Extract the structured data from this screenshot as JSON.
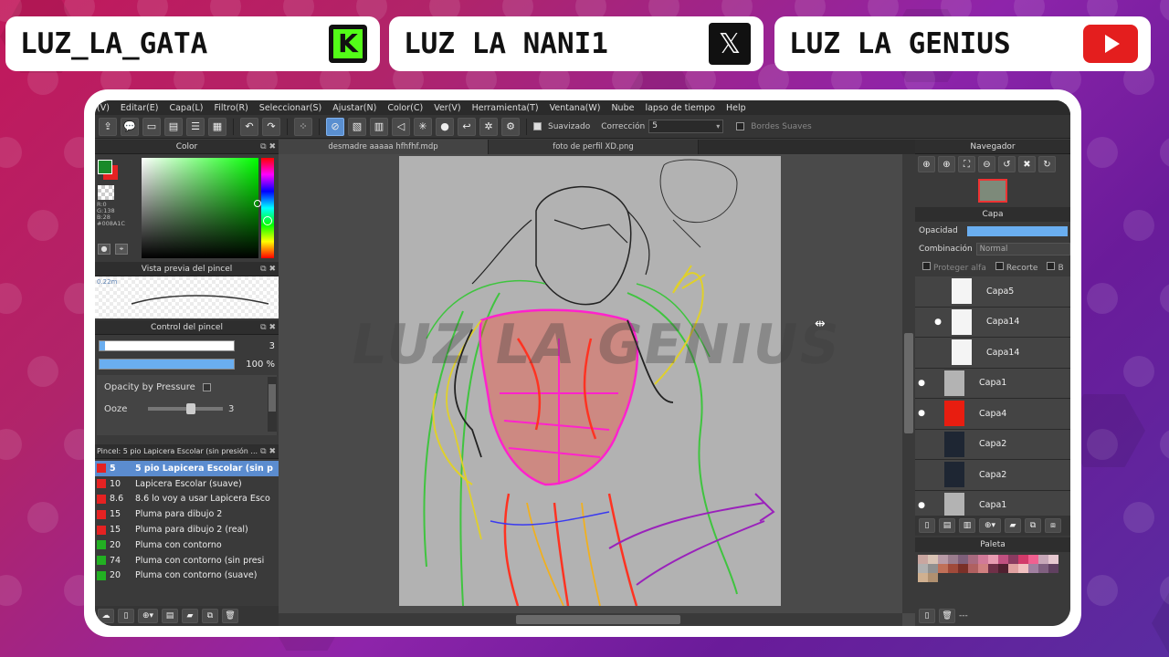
{
  "social": {
    "kick_name": "LUZ_LA_GATA",
    "x_name": "LUZ LA NANI1",
    "youtube_name": "LUZ LA GENIUS",
    "kick_glyph": "K",
    "x_glyph": "𝕏"
  },
  "menu": [
    "(V)",
    "Editar(E)",
    "Capa(L)",
    "Filtro(R)",
    "Seleccionar(S)",
    "Ajustar(N)",
    "Color(C)",
    "Ver(V)",
    "Herramienta(T)",
    "Ventana(W)",
    "Nube",
    "lapso de tiempo",
    "Help"
  ],
  "toolbar": {
    "suavizado": "Suavizado",
    "correccion": "Corrección",
    "correccion_value": "5",
    "bordes": "Bordes Suaves"
  },
  "color_panel": {
    "title": "Color",
    "rgb_text": "R:0\nG:138\nB:28\n#008A1C"
  },
  "brush_preview": {
    "title": "Vista previa del pincel",
    "size_label": "0.22m"
  },
  "brush_control": {
    "title": "Control del pincel",
    "size_value": "3",
    "opacity_value": "100 %",
    "size_fraction": 0.04,
    "opacity_fraction": 1.0,
    "opacity_pressure": "Opacity by Pressure",
    "ooze_label": "Ooze",
    "ooze_value": "3"
  },
  "brush_list": {
    "title": "Pincel: 5 pio Lapicera Escolar (sin presión ...",
    "items": [
      {
        "size": "5",
        "name": "5 pio Lapicera Escolar (sin p",
        "color": "#e52222",
        "selected": true
      },
      {
        "size": "10",
        "name": "Lapicera Escolar (suave)",
        "color": "#e52222"
      },
      {
        "size": "8.6",
        "name": "8.6 lo voy a usar Lapicera Esco",
        "color": "#e52222"
      },
      {
        "size": "15",
        "name": "Pluma para dibujo 2",
        "color": "#e52222"
      },
      {
        "size": "15",
        "name": "Pluma para dibujo 2 (real)",
        "color": "#e52222"
      },
      {
        "size": "20",
        "name": "Pluma con contorno",
        "color": "#22b022"
      },
      {
        "size": "74",
        "name": "Pluma con contorno (sin presi",
        "color": "#22b022"
      },
      {
        "size": "20",
        "name": "Pluma con contorno (suave)",
        "color": "#22b022"
      }
    ]
  },
  "tabs": [
    "desmadre aaaaa hfhfhf.mdp",
    "foto de perfil XD.png"
  ],
  "watermark": "LUZ LA GENIUS",
  "navigator": {
    "title": "Navegador"
  },
  "layers_panel": {
    "title": "Capa",
    "opacity_label": "Opacidad",
    "blend_label": "Combinación",
    "blend_value": "Normal",
    "protect_alpha": "Proteger alfa",
    "clip": "Recorte",
    "b_label": "B",
    "layers": [
      {
        "name": "Capa5",
        "thumb": "white",
        "visible": false,
        "sub": true
      },
      {
        "name": "Capa14",
        "thumb": "white",
        "visible": true,
        "sub": true
      },
      {
        "name": "Capa14",
        "thumb": "white",
        "visible": false,
        "sub": true
      },
      {
        "name": "Capa1",
        "thumb": "gray",
        "visible": true,
        "sub": false
      },
      {
        "name": "Capa4",
        "thumb": "red",
        "visible": true,
        "sub": false
      },
      {
        "name": "Capa2",
        "thumb": "fig",
        "visible": false,
        "sub": false
      },
      {
        "name": "Capa2",
        "thumb": "fig",
        "visible": false,
        "sub": false
      },
      {
        "name": "Capa1",
        "thumb": "gray",
        "visible": true,
        "sub": false
      }
    ]
  },
  "palette": {
    "title": "Paleta",
    "colors": [
      "#c9a6a0",
      "#d9c3b4",
      "#b89aa6",
      "#9a7c8d",
      "#7e5f7a",
      "#a86a7f",
      "#d17a98",
      "#e89bb1",
      "#c05080",
      "#8a3a60",
      "#d23a6a",
      "#f06090",
      "#c7a7b8",
      "#e6c8d0",
      "#b0b0b0",
      "#909090",
      "#c07058",
      "#a04a3a",
      "#7a3028",
      "#b06060",
      "#d08080",
      "#703048",
      "#502030",
      "#e0a0a0",
      "#f0c0c0",
      "#a080a0",
      "#806080",
      "#604060",
      "#d0b090",
      "#b09070"
    ],
    "more": "---"
  }
}
